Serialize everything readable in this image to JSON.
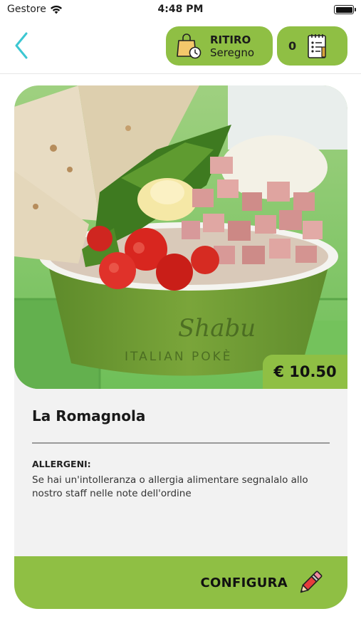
{
  "status_bar": {
    "carrier": "Gestore",
    "time": "4:48 PM"
  },
  "header": {
    "pickup": {
      "title": "RITIRO",
      "location": "Seregno"
    },
    "cart": {
      "count": "0"
    }
  },
  "product": {
    "price": "€ 10.50",
    "name": "La Romagnola",
    "bowl_brand": "Shabu",
    "bowl_subtitle": "ITALIAN POKÈ",
    "allergens_title": "ALLERGENI:",
    "allergens_text": "Se hai un'intolleranza o allergia alimentare segnalalo allo nostro staff nelle note dell'ordine"
  },
  "actions": {
    "configure_label": "CONFIGURA"
  },
  "colors": {
    "accent": "#8fbf44",
    "back_arrow": "#3cc7d2",
    "card_bg": "#f2f2f2"
  },
  "icons": {
    "back": "chevron-left-icon",
    "pickup": "shopping-bag-clock-icon",
    "cart": "order-list-icon",
    "configure": "pencil-icon"
  }
}
